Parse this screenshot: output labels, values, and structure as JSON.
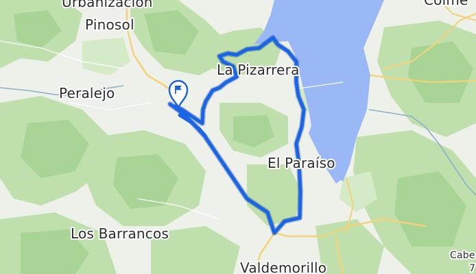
{
  "map": {
    "place_labels": {
      "urbanizacion": "Urbanización",
      "pinosol": "Pinosol",
      "peralejo": "Peralejo",
      "la_pizarrera": "La Pizarrera",
      "el_paraiso": "El Paraíso",
      "los_barrancos": "Los Barrancos",
      "valdemorillo": "Valdemorillo",
      "colmenarejo_partial": "Colme",
      "cabeza_partial": "Cabe",
      "cabeza_number_partial": "7"
    },
    "route": {
      "start_marker_icon": "flag-icon",
      "color": "#1a64e6"
    },
    "colors": {
      "background": "#eef0ea",
      "forest": "#b6dba3",
      "forest_light": "#cfe7c1",
      "water": "#9ab8f5",
      "road": "#f2d47c",
      "river": "#88b0c8"
    }
  }
}
